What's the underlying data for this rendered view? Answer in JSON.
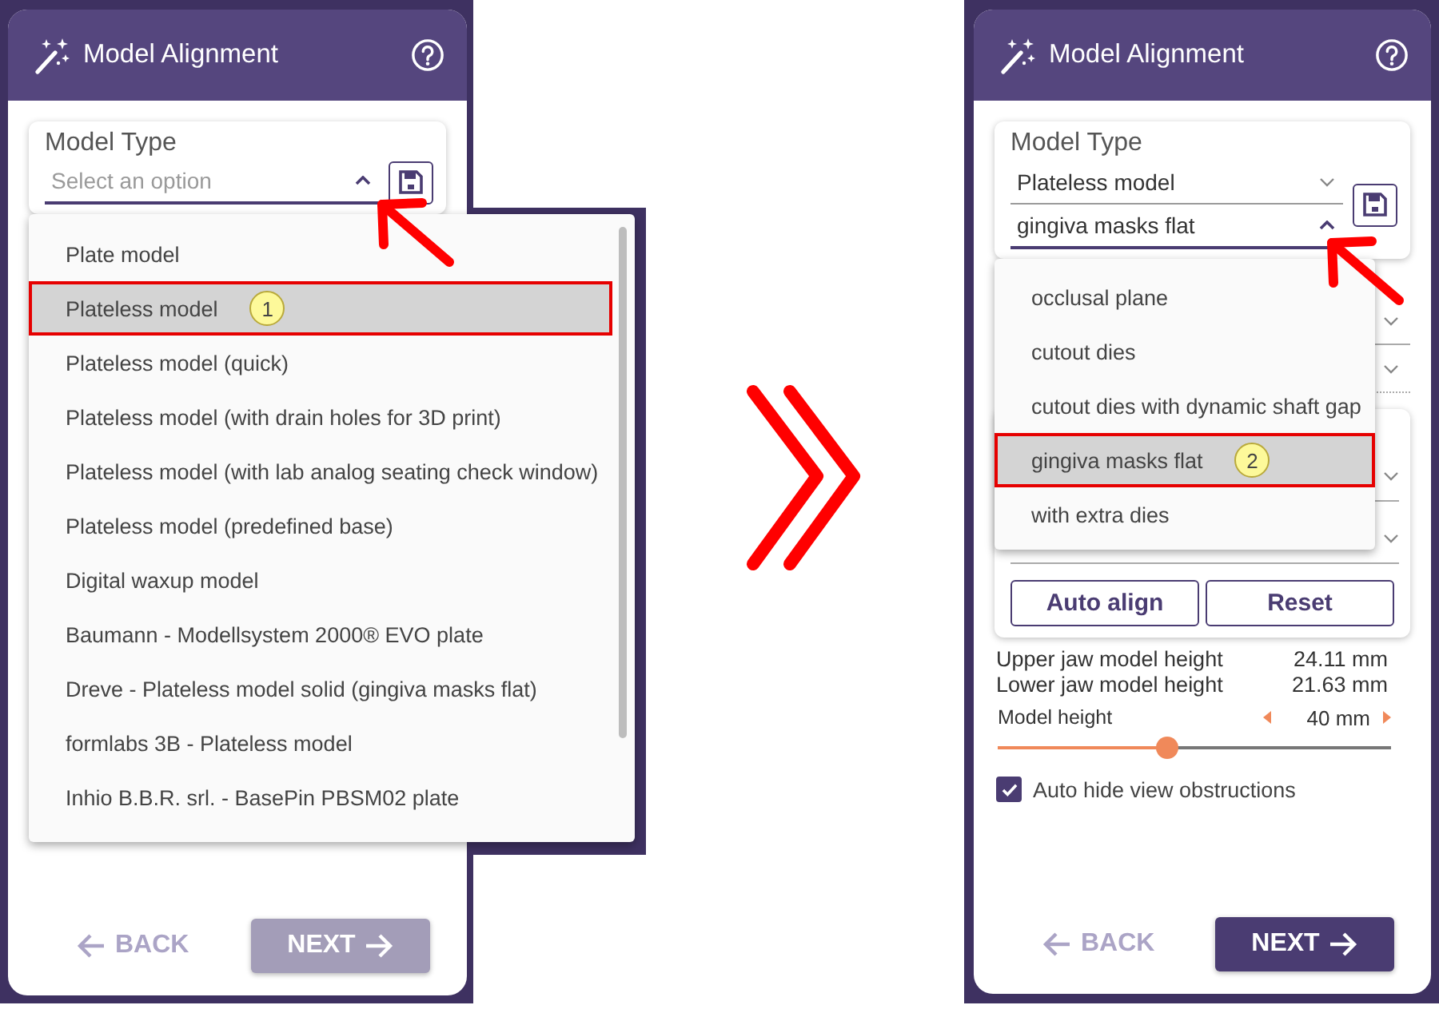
{
  "screens": [
    {
      "header": {
        "title": "Model Alignment"
      },
      "model_type": {
        "label": "Model Type",
        "selects": [
          {
            "placeholder": "Select an option",
            "expanded": true
          }
        ]
      },
      "dropdown": {
        "options": [
          {
            "label": "Plate model",
            "selected": false
          },
          {
            "label": "Plateless model",
            "selected": true,
            "callout": "1"
          },
          {
            "label": "Plateless model (quick)",
            "selected": false
          },
          {
            "label": "Plateless model (with drain holes for 3D print)",
            "selected": false
          },
          {
            "label": "Plateless model (with lab analog seating check window)",
            "selected": false
          },
          {
            "label": "Plateless model (predefined base)",
            "selected": false
          },
          {
            "label": "Digital waxup model",
            "selected": false
          },
          {
            "label": "Baumann - Modellsystem 2000® EVO plate",
            "selected": false
          },
          {
            "label": "Dreve - Plateless model solid (gingiva masks flat)",
            "selected": false
          },
          {
            "label": "formlabs 3B - Plateless model",
            "selected": false
          },
          {
            "label": "Inhio B.B.R. srl. - BasePin PBSM02 plate",
            "selected": false
          }
        ]
      },
      "footer": {
        "back": {
          "label": "BACK",
          "disabled": true
        },
        "next": {
          "label": "NEXT",
          "disabled": true
        }
      }
    },
    {
      "header": {
        "title": "Model Alignment"
      },
      "model_type": {
        "label": "Model Type",
        "selects": [
          {
            "value": "Plateless model",
            "expanded": false
          },
          {
            "value": "gingiva masks flat",
            "expanded": true
          }
        ]
      },
      "dropdown": {
        "options": [
          {
            "label": "occlusal plane",
            "selected": false
          },
          {
            "label": "cutout dies",
            "selected": false
          },
          {
            "label": "cutout dies with dynamic shaft gap",
            "selected": false
          },
          {
            "label": "gingiva masks flat",
            "selected": true,
            "callout": "2"
          },
          {
            "label": "with extra dies",
            "selected": false
          }
        ]
      },
      "actions": [
        {
          "label": "Auto align"
        },
        {
          "label": "Reset"
        }
      ],
      "measurements": [
        {
          "label": "Upper jaw model height",
          "value": "24.11 mm"
        },
        {
          "label": "Lower jaw model height",
          "value": "21.63 mm"
        }
      ],
      "slider": {
        "label": "Model height",
        "value": "40 mm",
        "level": 0.43
      },
      "checkbox": {
        "label": "Auto hide view obstructions",
        "checked": true
      },
      "footer": {
        "back": {
          "label": "BACK",
          "disabled": true
        },
        "next": {
          "label": "NEXT",
          "disabled": false
        }
      }
    }
  ]
}
